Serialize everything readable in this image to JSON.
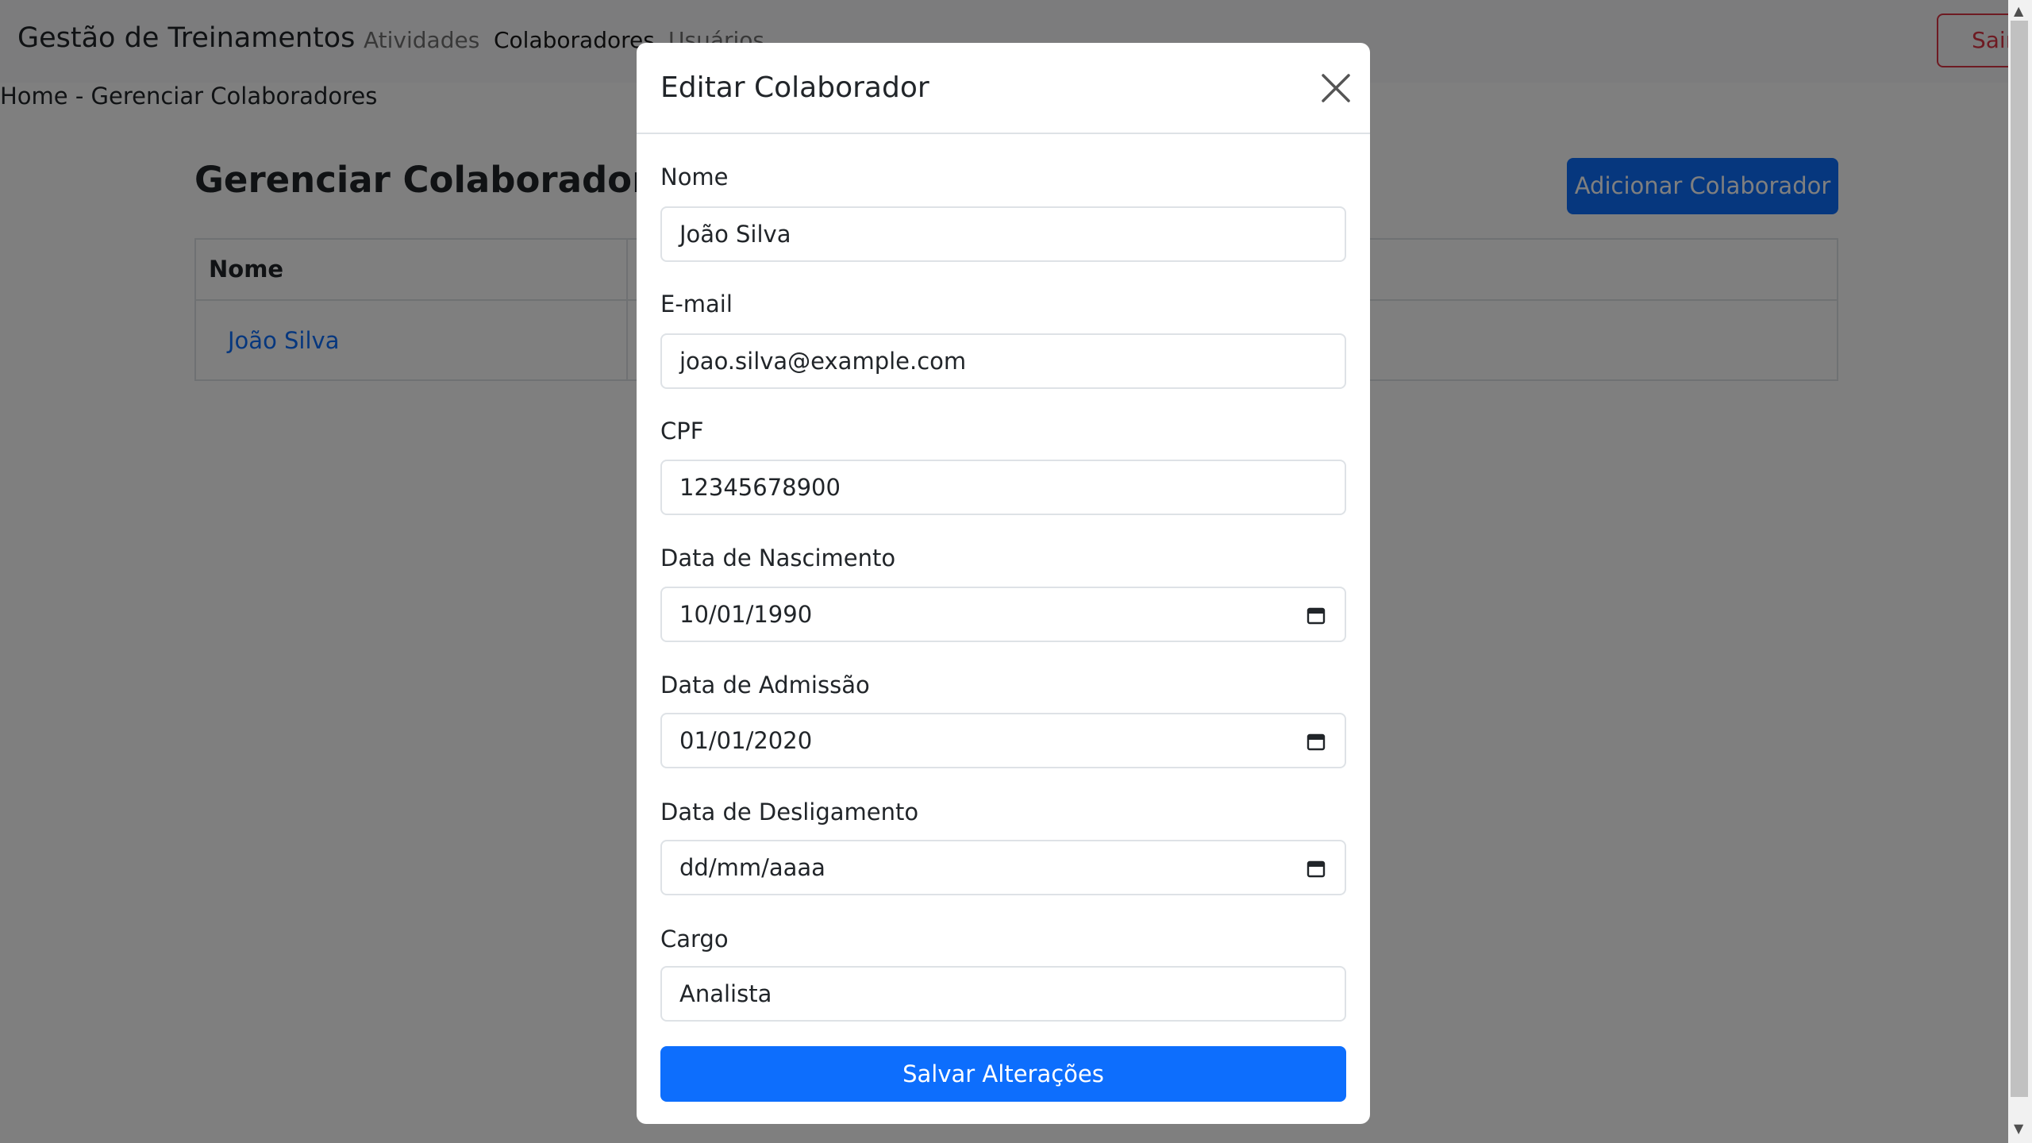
{
  "navbar": {
    "brand": "Gestão de Treinamentos",
    "links": [
      "Atividades",
      "Colaboradores",
      "Usuários"
    ],
    "logout_label": "Sair"
  },
  "breadcrumb": "Home - Gerenciar Colaboradores",
  "page": {
    "title": "Gerenciar Colaboradores",
    "add_button_label": "Adicionar Colaborador",
    "table": {
      "headers": [
        "Nome"
      ],
      "rows": [
        [
          "João Silva"
        ]
      ]
    }
  },
  "modal": {
    "title": "Editar Colaborador",
    "fields": {
      "nome": {
        "label": "Nome",
        "value": "João Silva"
      },
      "email": {
        "label": "E-mail",
        "value": "joao.silva@example.com"
      },
      "cpf": {
        "label": "CPF",
        "value": "12345678900"
      },
      "nascimento": {
        "label": "Data de Nascimento",
        "value": "10/01/1990"
      },
      "admissao": {
        "label": "Data de Admissão",
        "value": "01/01/2020"
      },
      "desligamento": {
        "label": "Data de Desligamento",
        "value": "dd/mm/aaaa"
      },
      "cargo": {
        "label": "Cargo",
        "value": "Analista"
      }
    },
    "save_label": "Salvar Alterações"
  },
  "icons": {
    "close": "close-icon",
    "calendar": "calendar-icon"
  },
  "colors": {
    "primary": "#0d6efd",
    "danger": "#dc3545"
  }
}
